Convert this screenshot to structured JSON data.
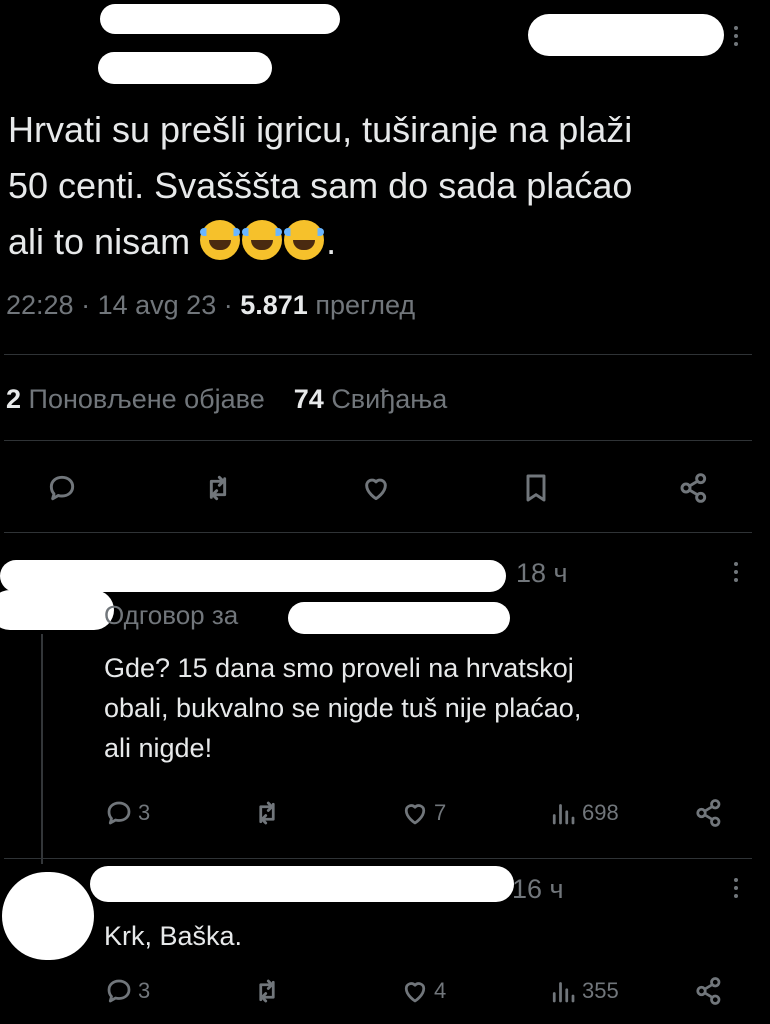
{
  "tweet": {
    "text_lines": [
      "Hrvati su prešli igricu, tuširanje na plaži",
      "50 centi. Svašššta sam do sada plaćao",
      "ali to nisam"
    ],
    "text_tail": ".",
    "emoji_name": "rolling-on-floor-laughing",
    "emoji_count": 3,
    "time": "22:28",
    "sep": "·",
    "date": "14 avg 23",
    "views_count": "5.871",
    "views_label": "преглед"
  },
  "stats": {
    "reposts_count": "2",
    "reposts_label": "Поновљене објаве",
    "likes_count": "74",
    "likes_label": "Свиђања"
  },
  "actions": [
    "reply-icon",
    "repost-icon",
    "like-icon",
    "bookmark-icon",
    "share-icon"
  ],
  "replies": [
    {
      "time": "18 ч",
      "replying_prefix": "Одговор за",
      "text_lines": [
        "Gde? 15 dana smo proveli na hrvatskoj",
        "obali, bukvalno se nigde tuš nije plaćao,",
        "ali nigde!"
      ],
      "reply_count": "3",
      "like_count": "7",
      "view_count": "698"
    },
    {
      "time": "16 ч",
      "text_lines": [
        "Krk, Baška."
      ],
      "reply_count": "3",
      "like_count": "4",
      "view_count": "355"
    }
  ],
  "colors": {
    "background": "#000000",
    "text": "#e7e9ea",
    "muted": "#71767b",
    "divider": "#2f3336",
    "redaction": "#ffffff"
  }
}
